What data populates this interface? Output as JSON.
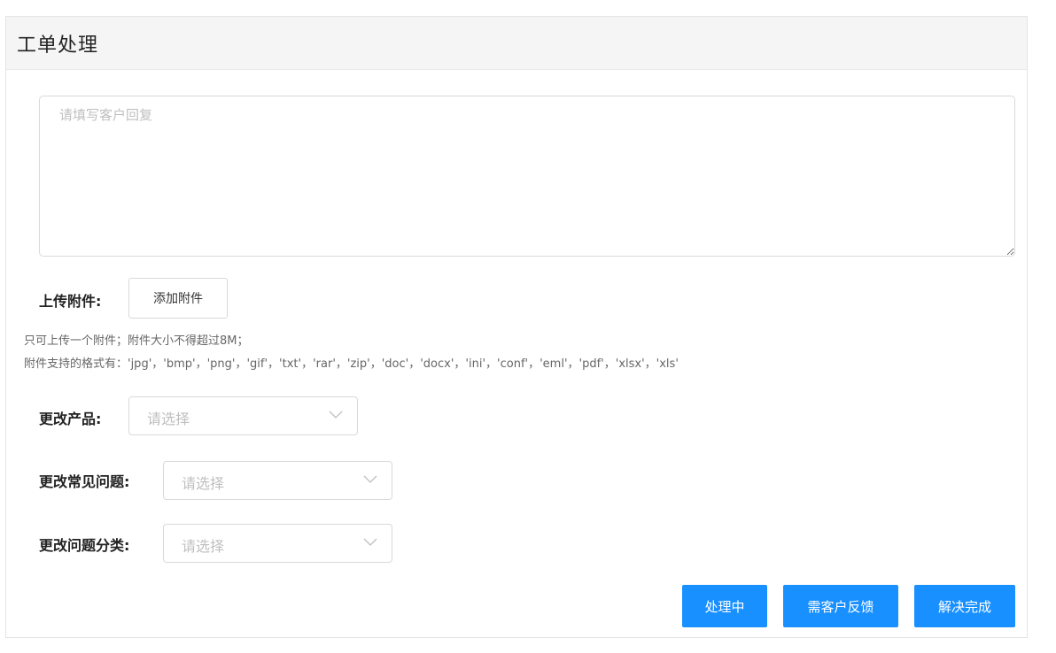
{
  "panel": {
    "title": "工单处理"
  },
  "reply": {
    "placeholder": "请填写客户回复"
  },
  "upload": {
    "label": "上传附件:",
    "button_label": "添加附件",
    "hint_line1": "只可上传一个附件；附件大小不得超过8M；",
    "hint_line2": "附件支持的格式有：'jpg'，'bmp'，'png'，'gif'，'txt'，'rar'，'zip'，'doc'，'docx'，'ini'，'conf'，'eml'，'pdf'，'xlsx'，'xls'"
  },
  "fields": {
    "product": {
      "label": "更改产品:",
      "placeholder": "请选择"
    },
    "faq": {
      "label": "更改常见问题:",
      "placeholder": "请选择"
    },
    "category": {
      "label": "更改问题分类:",
      "placeholder": "请选择"
    }
  },
  "actions": {
    "processing": "处理中",
    "need_feedback": "需客户反馈",
    "resolved": "解决完成"
  },
  "colors": {
    "primary": "#1890ff",
    "border": "#d9d9d9",
    "placeholder": "#bfbfbf"
  },
  "icons": {
    "select_arrow": "chevron-down-icon"
  }
}
